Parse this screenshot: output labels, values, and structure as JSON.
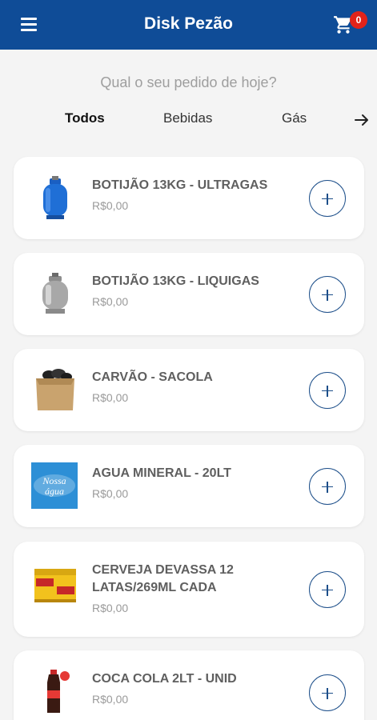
{
  "app_bar": {
    "title": "Disk Pezão",
    "cart_count": "0"
  },
  "prompt": "Qual o seu pedido de hoje?",
  "tabs": [
    {
      "label": "Todos",
      "active": true
    },
    {
      "label": "Bebidas",
      "active": false
    },
    {
      "label": "Gás",
      "active": false
    }
  ],
  "products": [
    {
      "name": "BOTIJÃO 13KG - ULTRAGAS",
      "price": "R$0,00",
      "icon": "gas-cylinder-blue-icon"
    },
    {
      "name": "BOTIJÃO 13KG - LIQUIGAS",
      "price": "R$0,00",
      "icon": "gas-cylinder-gray-icon"
    },
    {
      "name": "CARVÃO - SACOLA",
      "price": "R$0,00",
      "icon": "charcoal-bag-icon"
    },
    {
      "name": "AGUA MINERAL - 20LT",
      "price": "R$0,00",
      "icon": "water-brand-logo"
    },
    {
      "name": "CERVEJA DEVASSA 12 LATAS/269ML CADA",
      "price": "R$0,00",
      "icon": "beer-pack-icon"
    },
    {
      "name": "COCA COLA 2LT - UNID",
      "price": "R$0,00",
      "icon": "cola-bottle-icon"
    }
  ],
  "logo_text": "Nossa água",
  "colors": {
    "primary": "#0f4c97",
    "badge": "#e2231a",
    "background": "#f4f4f4"
  }
}
